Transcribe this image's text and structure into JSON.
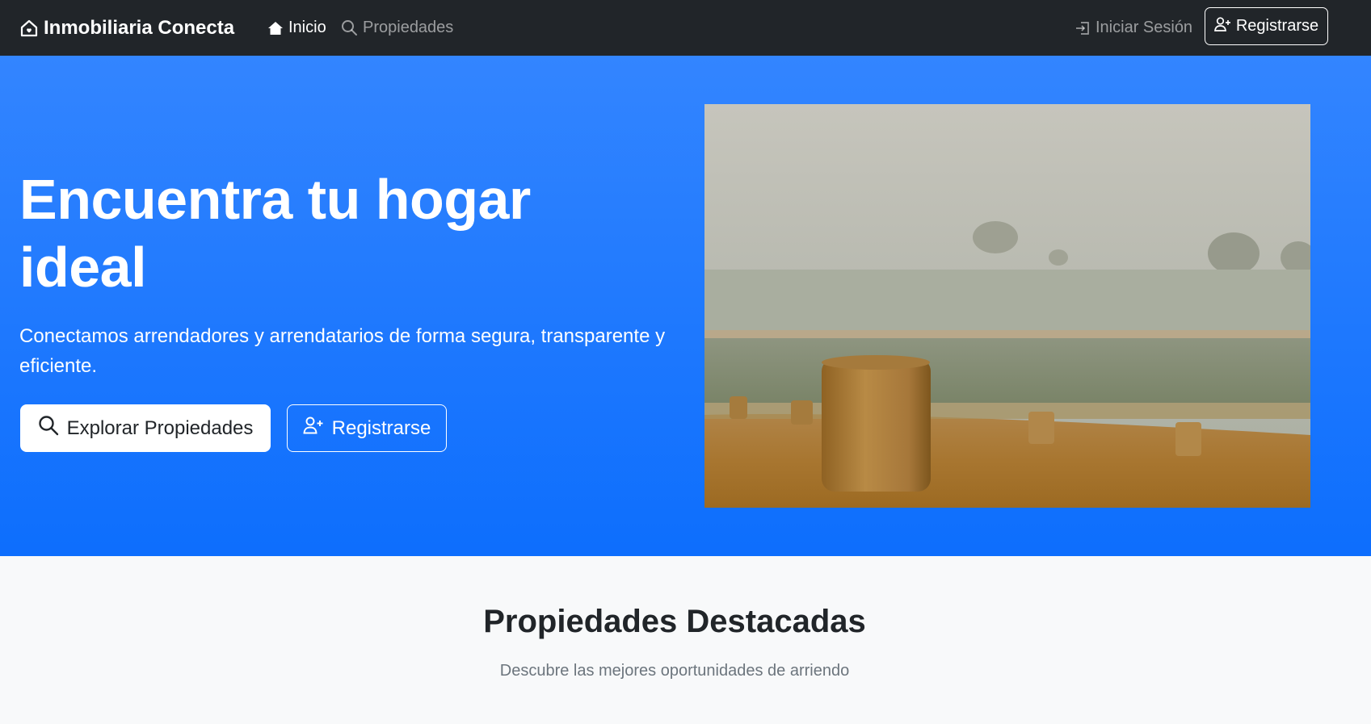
{
  "navbar": {
    "brand": "Inmobiliaria Conecta",
    "brand_icon": "house-heart-icon",
    "links": [
      {
        "label": "Inicio",
        "icon": "house-icon",
        "active": true
      },
      {
        "label": "Propiedades",
        "icon": "search-icon",
        "active": false
      }
    ],
    "login_label": "Iniciar Sesión",
    "register_label": "Registrarse"
  },
  "hero": {
    "title": "Encuentra tu hogar ideal",
    "subtitle": "Conectamos arrendadores y arrendatarios de forma segura, transparente y eficiente.",
    "explore_label": "Explorar Propiedades",
    "register_label": "Registrarse",
    "gradient_top": "#3385ff",
    "gradient_bottom": "#0d6efd"
  },
  "featured": {
    "title": "Propiedades Destacadas",
    "subtitle": "Descubre las mejores oportunidades de arriendo"
  },
  "colors": {
    "navbar_bg": "#212529",
    "page_bg": "#f8f9fa",
    "muted_text": "#6c757d"
  }
}
